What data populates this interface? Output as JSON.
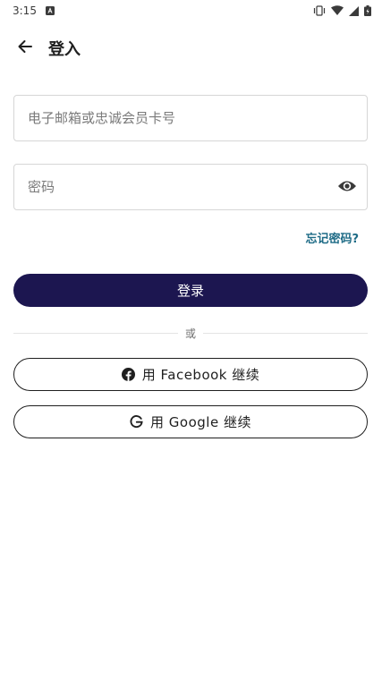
{
  "status_bar": {
    "time": "3:15"
  },
  "header": {
    "title": "登入"
  },
  "form": {
    "email_placeholder": "电子邮箱或忠诚会员卡号",
    "password_placeholder": "密码",
    "forgot_password": "忘记密码?",
    "login_label": "登录"
  },
  "divider": {
    "text": "或"
  },
  "social": {
    "facebook_label": "用 Facebook 继续",
    "google_label": "用 Google 继续"
  },
  "colors": {
    "primary": "#1c1650",
    "link": "#1e6b86"
  },
  "icons": {
    "back": "arrow-left-icon",
    "password_toggle": "eye-icon",
    "facebook": "facebook-icon",
    "google": "google-icon"
  }
}
